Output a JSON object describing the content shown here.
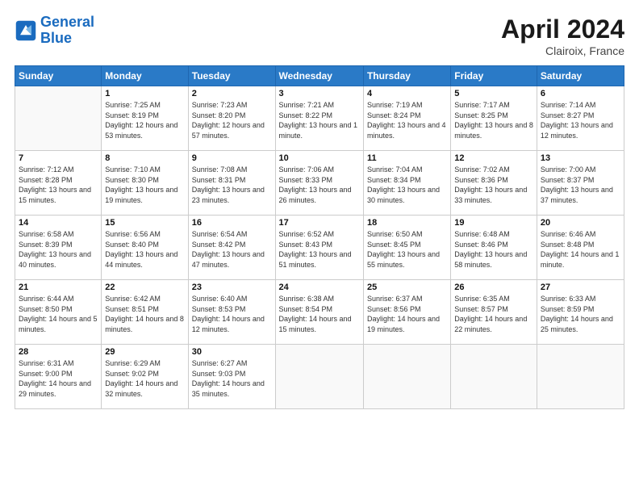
{
  "header": {
    "logo_general": "General",
    "logo_blue": "Blue",
    "title": "April 2024",
    "location": "Clairoix, France"
  },
  "weekdays": [
    "Sunday",
    "Monday",
    "Tuesday",
    "Wednesday",
    "Thursday",
    "Friday",
    "Saturday"
  ],
  "weeks": [
    [
      {
        "day": "",
        "sunrise": "",
        "sunset": "",
        "daylight": ""
      },
      {
        "day": "1",
        "sunrise": "Sunrise: 7:25 AM",
        "sunset": "Sunset: 8:19 PM",
        "daylight": "Daylight: 12 hours and 53 minutes."
      },
      {
        "day": "2",
        "sunrise": "Sunrise: 7:23 AM",
        "sunset": "Sunset: 8:20 PM",
        "daylight": "Daylight: 12 hours and 57 minutes."
      },
      {
        "day": "3",
        "sunrise": "Sunrise: 7:21 AM",
        "sunset": "Sunset: 8:22 PM",
        "daylight": "Daylight: 13 hours and 1 minute."
      },
      {
        "day": "4",
        "sunrise": "Sunrise: 7:19 AM",
        "sunset": "Sunset: 8:24 PM",
        "daylight": "Daylight: 13 hours and 4 minutes."
      },
      {
        "day": "5",
        "sunrise": "Sunrise: 7:17 AM",
        "sunset": "Sunset: 8:25 PM",
        "daylight": "Daylight: 13 hours and 8 minutes."
      },
      {
        "day": "6",
        "sunrise": "Sunrise: 7:14 AM",
        "sunset": "Sunset: 8:27 PM",
        "daylight": "Daylight: 13 hours and 12 minutes."
      }
    ],
    [
      {
        "day": "7",
        "sunrise": "Sunrise: 7:12 AM",
        "sunset": "Sunset: 8:28 PM",
        "daylight": "Daylight: 13 hours and 15 minutes."
      },
      {
        "day": "8",
        "sunrise": "Sunrise: 7:10 AM",
        "sunset": "Sunset: 8:30 PM",
        "daylight": "Daylight: 13 hours and 19 minutes."
      },
      {
        "day": "9",
        "sunrise": "Sunrise: 7:08 AM",
        "sunset": "Sunset: 8:31 PM",
        "daylight": "Daylight: 13 hours and 23 minutes."
      },
      {
        "day": "10",
        "sunrise": "Sunrise: 7:06 AM",
        "sunset": "Sunset: 8:33 PM",
        "daylight": "Daylight: 13 hours and 26 minutes."
      },
      {
        "day": "11",
        "sunrise": "Sunrise: 7:04 AM",
        "sunset": "Sunset: 8:34 PM",
        "daylight": "Daylight: 13 hours and 30 minutes."
      },
      {
        "day": "12",
        "sunrise": "Sunrise: 7:02 AM",
        "sunset": "Sunset: 8:36 PM",
        "daylight": "Daylight: 13 hours and 33 minutes."
      },
      {
        "day": "13",
        "sunrise": "Sunrise: 7:00 AM",
        "sunset": "Sunset: 8:37 PM",
        "daylight": "Daylight: 13 hours and 37 minutes."
      }
    ],
    [
      {
        "day": "14",
        "sunrise": "Sunrise: 6:58 AM",
        "sunset": "Sunset: 8:39 PM",
        "daylight": "Daylight: 13 hours and 40 minutes."
      },
      {
        "day": "15",
        "sunrise": "Sunrise: 6:56 AM",
        "sunset": "Sunset: 8:40 PM",
        "daylight": "Daylight: 13 hours and 44 minutes."
      },
      {
        "day": "16",
        "sunrise": "Sunrise: 6:54 AM",
        "sunset": "Sunset: 8:42 PM",
        "daylight": "Daylight: 13 hours and 47 minutes."
      },
      {
        "day": "17",
        "sunrise": "Sunrise: 6:52 AM",
        "sunset": "Sunset: 8:43 PM",
        "daylight": "Daylight: 13 hours and 51 minutes."
      },
      {
        "day": "18",
        "sunrise": "Sunrise: 6:50 AM",
        "sunset": "Sunset: 8:45 PM",
        "daylight": "Daylight: 13 hours and 55 minutes."
      },
      {
        "day": "19",
        "sunrise": "Sunrise: 6:48 AM",
        "sunset": "Sunset: 8:46 PM",
        "daylight": "Daylight: 13 hours and 58 minutes."
      },
      {
        "day": "20",
        "sunrise": "Sunrise: 6:46 AM",
        "sunset": "Sunset: 8:48 PM",
        "daylight": "Daylight: 14 hours and 1 minute."
      }
    ],
    [
      {
        "day": "21",
        "sunrise": "Sunrise: 6:44 AM",
        "sunset": "Sunset: 8:50 PM",
        "daylight": "Daylight: 14 hours and 5 minutes."
      },
      {
        "day": "22",
        "sunrise": "Sunrise: 6:42 AM",
        "sunset": "Sunset: 8:51 PM",
        "daylight": "Daylight: 14 hours and 8 minutes."
      },
      {
        "day": "23",
        "sunrise": "Sunrise: 6:40 AM",
        "sunset": "Sunset: 8:53 PM",
        "daylight": "Daylight: 14 hours and 12 minutes."
      },
      {
        "day": "24",
        "sunrise": "Sunrise: 6:38 AM",
        "sunset": "Sunset: 8:54 PM",
        "daylight": "Daylight: 14 hours and 15 minutes."
      },
      {
        "day": "25",
        "sunrise": "Sunrise: 6:37 AM",
        "sunset": "Sunset: 8:56 PM",
        "daylight": "Daylight: 14 hours and 19 minutes."
      },
      {
        "day": "26",
        "sunrise": "Sunrise: 6:35 AM",
        "sunset": "Sunset: 8:57 PM",
        "daylight": "Daylight: 14 hours and 22 minutes."
      },
      {
        "day": "27",
        "sunrise": "Sunrise: 6:33 AM",
        "sunset": "Sunset: 8:59 PM",
        "daylight": "Daylight: 14 hours and 25 minutes."
      }
    ],
    [
      {
        "day": "28",
        "sunrise": "Sunrise: 6:31 AM",
        "sunset": "Sunset: 9:00 PM",
        "daylight": "Daylight: 14 hours and 29 minutes."
      },
      {
        "day": "29",
        "sunrise": "Sunrise: 6:29 AM",
        "sunset": "Sunset: 9:02 PM",
        "daylight": "Daylight: 14 hours and 32 minutes."
      },
      {
        "day": "30",
        "sunrise": "Sunrise: 6:27 AM",
        "sunset": "Sunset: 9:03 PM",
        "daylight": "Daylight: 14 hours and 35 minutes."
      },
      {
        "day": "",
        "sunrise": "",
        "sunset": "",
        "daylight": ""
      },
      {
        "day": "",
        "sunrise": "",
        "sunset": "",
        "daylight": ""
      },
      {
        "day": "",
        "sunrise": "",
        "sunset": "",
        "daylight": ""
      },
      {
        "day": "",
        "sunrise": "",
        "sunset": "",
        "daylight": ""
      }
    ]
  ]
}
